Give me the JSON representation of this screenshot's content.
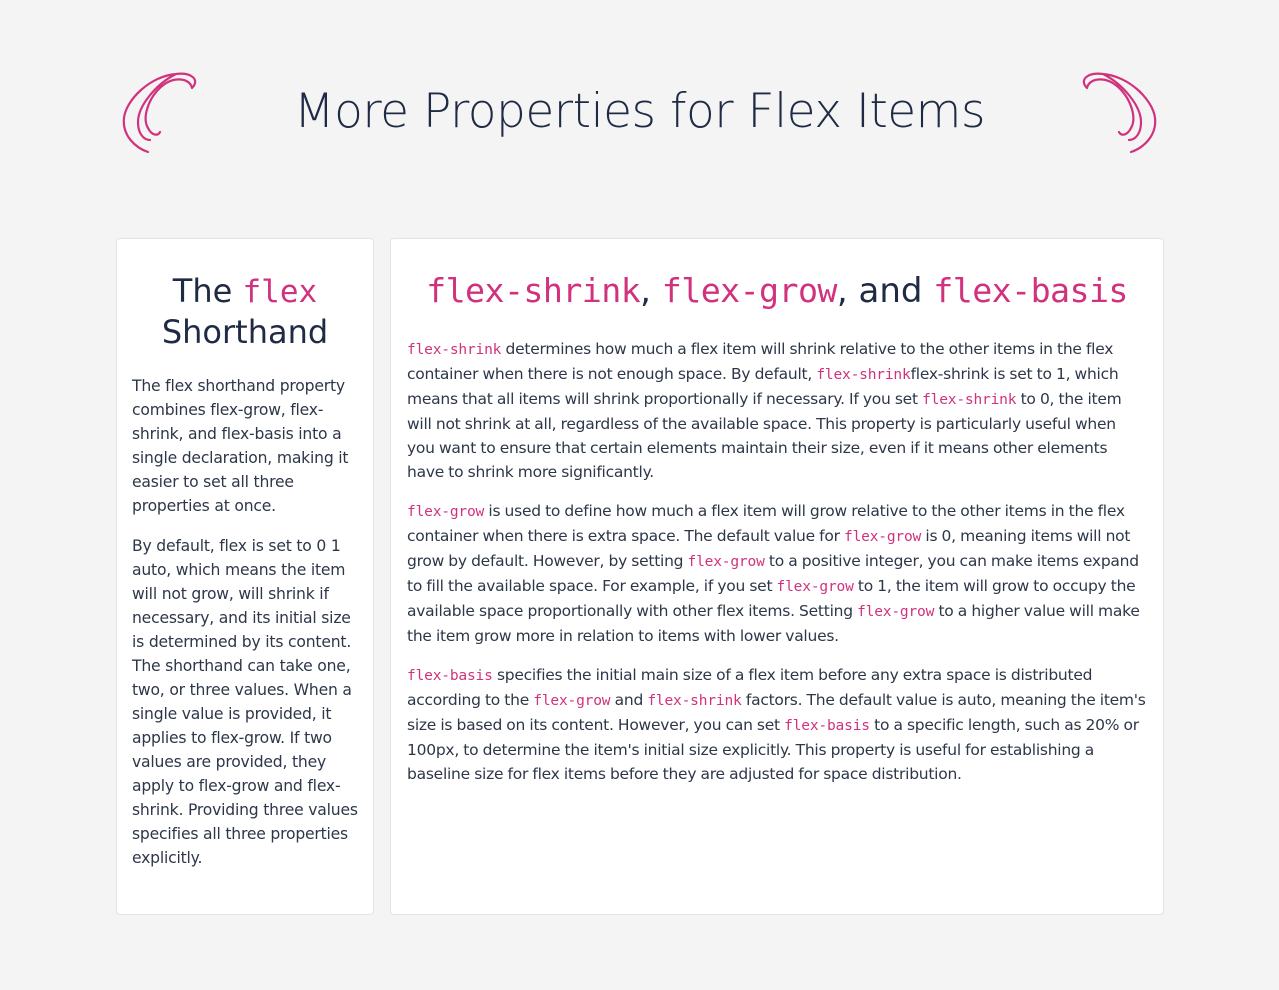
{
  "page": {
    "title": "More Properties for Flex Items",
    "accent_color": "#d1327d",
    "background_color": "#f4f4f5"
  },
  "left_card": {
    "title_prefix": "The",
    "title_code": "flex",
    "title_suffix": "Shorthand",
    "paragraphs": [
      "The flex shorthand property combines flex-grow, flex-shrink, and flex-basis into a single declaration, making it easier to set all three properties at once.",
      "By default, flex is set to 0 1 auto, which means the item will not grow, will shrink if necessary, and its initial size is determined by its content. The shorthand can take one, two, or three values. When a single value is provided, it applies to flex-grow. If two values are provided, they apply to flex-grow and flex-shrink. Providing three values specifies all three properties explicitly."
    ]
  },
  "right_card": {
    "title": {
      "code_1": "flex-shrink",
      "sep_1": ",",
      "code_2": "flex-grow",
      "sep_2": ", and",
      "code_3": "flex-basis"
    },
    "shrink_paragraph": {
      "code_1": "flex-shrink",
      "text_1": " determines how much a flex item will shrink relative to the other items in the flex container when there is not enough space. By default, ",
      "code_2": "flex-shrink",
      "text_2": "flex-shrink is set to 1, which means that all items will shrink proportionally if necessary. If you set ",
      "code_3": "flex-shrink",
      "text_3": " to 0, the item will not shrink at all, regardless of the available space. This property is particularly useful when you want to ensure that certain elements maintain their size, even if it means other elements have to shrink more significantly."
    },
    "grow_paragraph": {
      "code_1": "flex-grow",
      "text_1": " is used to define how much a flex item will grow relative to the other items in the flex container when there is extra space. The default value for ",
      "code_2": "flex-grow",
      "text_2": " is 0, meaning items will not grow by default. However, by setting ",
      "code_3": "flex-grow",
      "text_3": " to a positive integer, you can make items expand to fill the available space. For example, if you set ",
      "code_4": "flex-grow",
      "text_4": " to 1, the item will grow to occupy the available space proportionally with other flex items. Setting ",
      "code_5": "flex-grow",
      "text_5": " to a higher value will make the item grow more in relation to items with lower values."
    },
    "basis_paragraph": {
      "code_1": "flex-basis",
      "text_1": " specifies the initial main size of a flex item before any extra space is distributed according to the ",
      "code_2": "flex-grow",
      "text_2": " and ",
      "code_3": "flex-shrink",
      "text_3": " factors. The default value is auto, meaning the item's size is based on its content. However, you can set ",
      "code_4": "flex-basis",
      "text_4": " to a specific length, such as 20% or 100px, to determine the item's initial size explicitly. This property is useful for establishing a baseline size for flex items before they are adjusted for space distribution."
    }
  }
}
